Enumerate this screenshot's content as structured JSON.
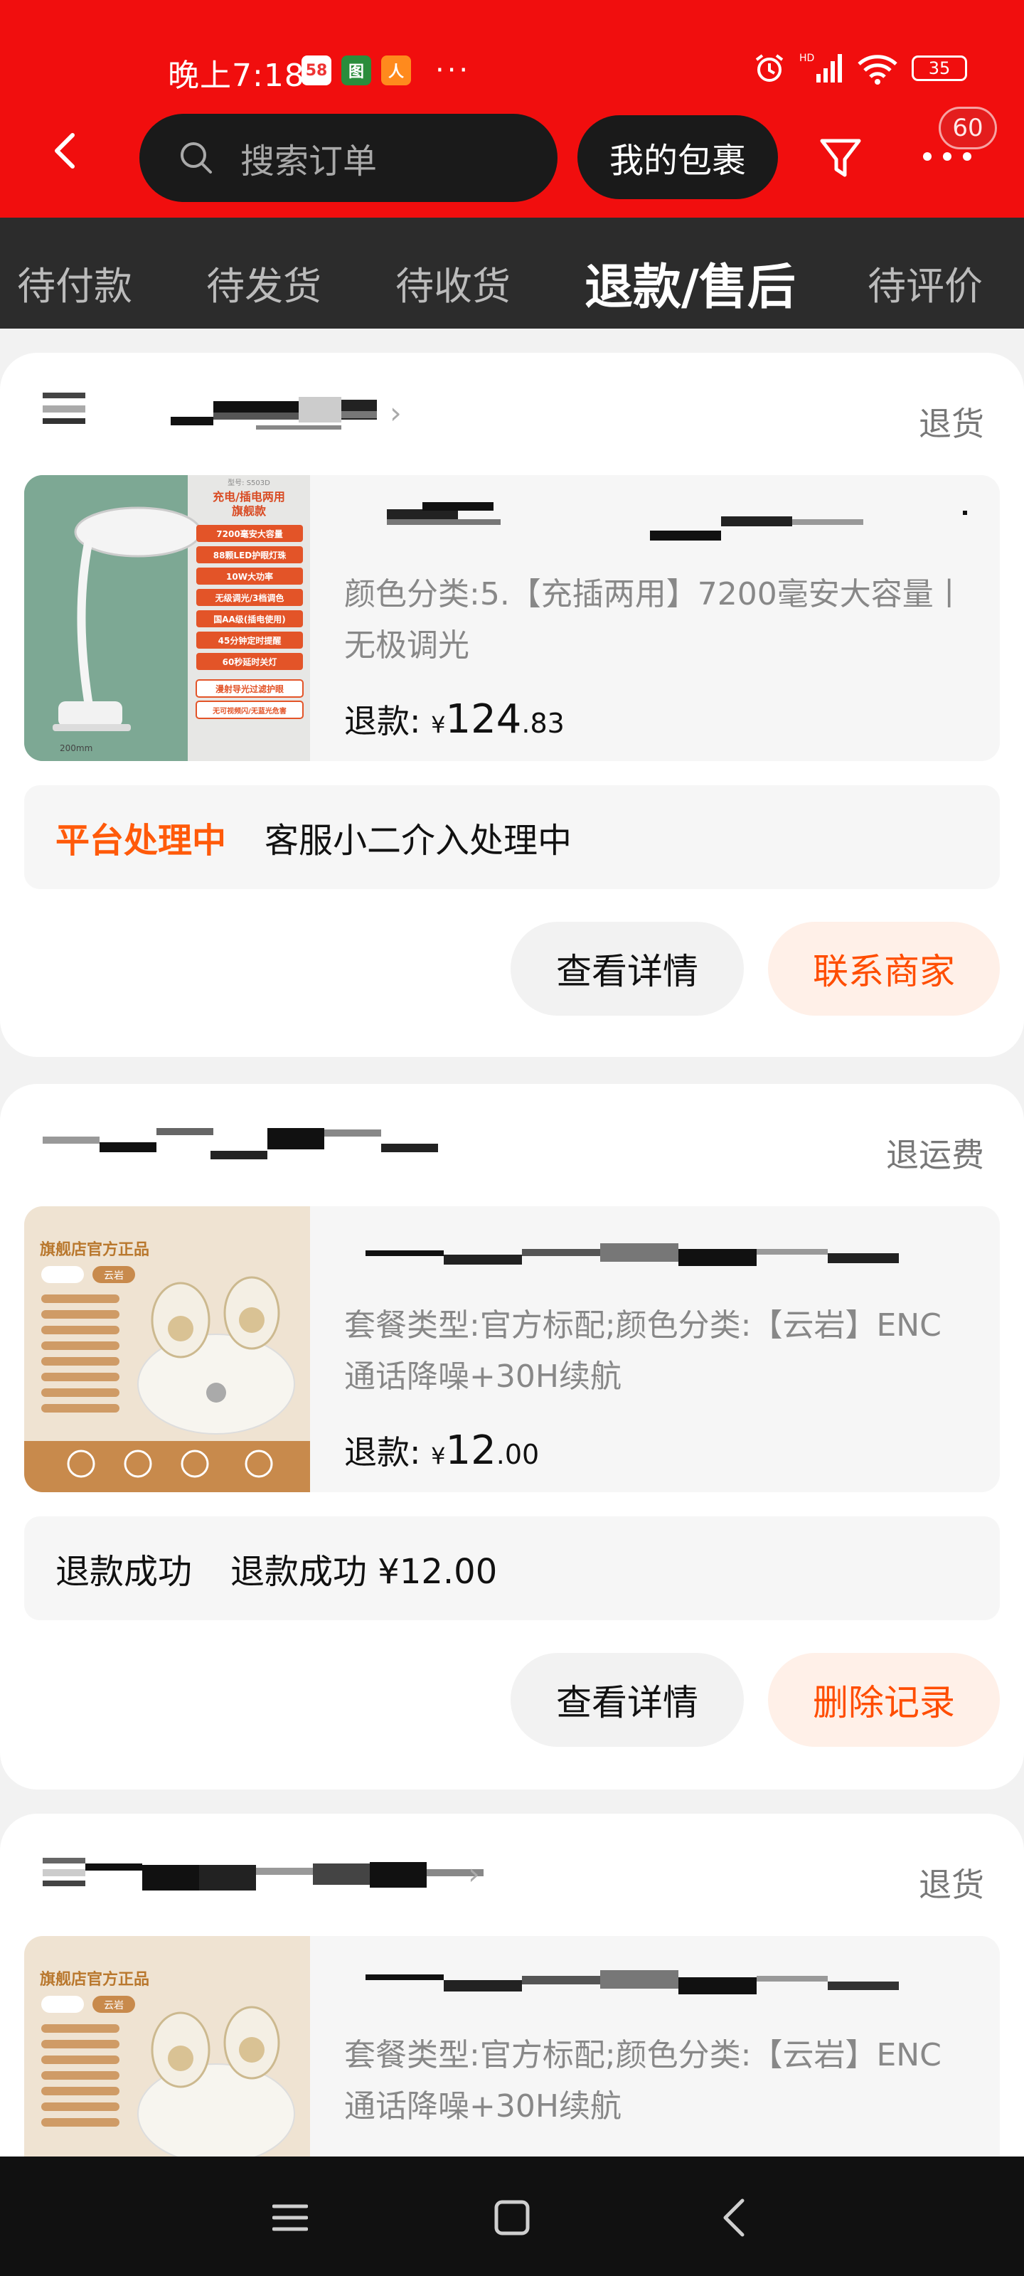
{
  "status_bar": {
    "time": "晚上7:18",
    "app_icons": [
      "58",
      "图",
      "人"
    ],
    "more": "···",
    "battery": "35"
  },
  "header": {
    "search_placeholder": "搜索订单",
    "package_button": "我的包裹",
    "message_badge": "60"
  },
  "tabs": [
    {
      "label": "待付款",
      "active": false
    },
    {
      "label": "待发货",
      "active": false
    },
    {
      "label": "待收货",
      "active": false
    },
    {
      "label": "退款/售后",
      "active": true
    },
    {
      "label": "待评价",
      "active": false
    }
  ],
  "orders": [
    {
      "status": "退货",
      "spec": "颜色分类:5.【充插两用】7200毫安大容量丨无极调光",
      "refund_label": "退款:",
      "currency": "¥",
      "amount_int": "124",
      "amount_dec": ".83",
      "process_label": "平台处理中",
      "process_text": "客服小二介入处理中",
      "btn_left": "查看详情",
      "btn_right": "联系商家",
      "thumb_lines": [
        "型号: S503D",
        "充电/插电两用",
        "旗舰款",
        "7200毫安大容量",
        "88颗LED护眼灯珠",
        "10W大功率",
        "无级调光/3档调色",
        "国AA级(插电使用)",
        "45分钟定时提醒",
        "60秒延时关灯",
        "漫射导光过滤护眼",
        "无可视频闪/无蓝光危害",
        "200mm"
      ]
    },
    {
      "status": "退运费",
      "spec": "套餐类型:官方标配;颜色分类:【云岩】ENC通话降噪+30H续航",
      "refund_label": "退款:",
      "currency": "¥",
      "amount_int": "12",
      "amount_dec": ".00",
      "process_label": "退款成功",
      "process_text": "退款成功 ¥12.00",
      "btn_left": "查看详情",
      "btn_right": "删除记录",
      "thumb_lines": [
        "旗舰店官方正品",
        "云岩"
      ]
    },
    {
      "status": "退货",
      "spec": "套餐类型:官方标配;颜色分类:【云岩】ENC通话降噪+30H续航",
      "thumb_lines": [
        "旗舰店官方正品",
        "云岩"
      ]
    }
  ],
  "colors": {
    "header_red": "#f10e0e",
    "tabs_dark": "#2c2c2c",
    "accent_orange": "#ff5a0a"
  }
}
